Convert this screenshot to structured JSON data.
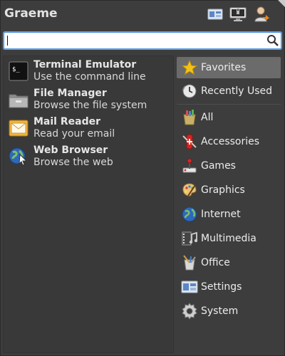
{
  "header": {
    "user_name": "Graeme"
  },
  "search": {
    "value": "",
    "placeholder": ""
  },
  "apps": [
    {
      "name": "Terminal Emulator",
      "description": "Use the command line",
      "icon": "terminal-icon"
    },
    {
      "name": "File Manager",
      "description": "Browse the file system",
      "icon": "folder-icon"
    },
    {
      "name": "Mail Reader",
      "description": "Read your email",
      "icon": "mail-icon"
    },
    {
      "name": "Web Browser",
      "description": "Browse the web",
      "icon": "web-browser-icon"
    }
  ],
  "categories": {
    "favorites": "Favorites",
    "recent": "Recently Used",
    "all": "All",
    "accessories": "Accessories",
    "games": "Games",
    "graphics": "Graphics",
    "internet": "Internet",
    "multimedia": "Multimedia",
    "office": "Office",
    "settings": "Settings",
    "system": "System"
  },
  "colors": {
    "background": "#3d3d3d",
    "selected": "#6b6b6b",
    "search_border": "#4a90d9"
  }
}
